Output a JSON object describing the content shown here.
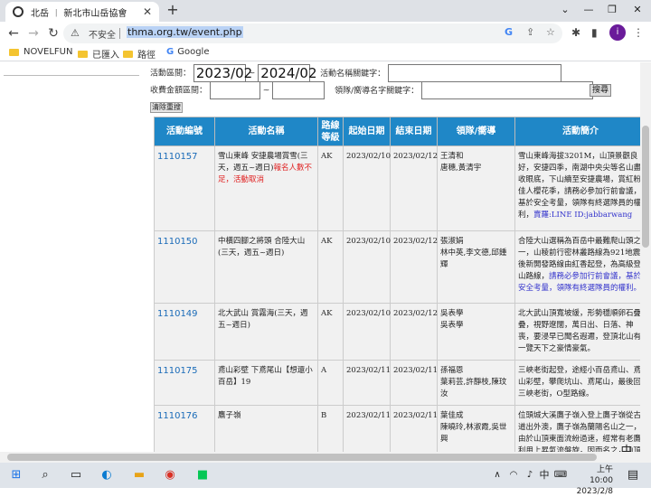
{
  "browser": {
    "tab_title": "北岳 ︱ 新北市山岳協會",
    "url": "thma.org.tw/event.php",
    "insecure_label": "不安全",
    "profile_initial": "i",
    "bookmarks": [
      "NOVELFUN",
      "已匯入",
      "路徑",
      "Google"
    ]
  },
  "search_form": {
    "date_label": "活動區間：",
    "date_from": "2023/02",
    "date_to": "2024/02",
    "name_keyword_label": "活動名稱關鍵字：",
    "fee_label": "收費金額區間：",
    "tilde": "~",
    "leader_keyword_label": "領隊/嚮導名字關鍵字：",
    "search_button": "搜尋",
    "clear_button": "清除重搜"
  },
  "table": {
    "headers": [
      "活動編號",
      "活動名稱",
      "路線等級",
      "起始日期",
      "結束日期",
      "領隊/嚮導",
      "活動簡介"
    ],
    "rows": [
      {
        "id": "1110157",
        "name": "雪山東峰 安捷農場賞雪(三天，週五~週日)",
        "name_note": "報名人數不足，活動取消",
        "level": "AK",
        "start": "2023/02/10",
        "end": "2023/02/12",
        "leaders": "王清和\n唐穗,黃清宇",
        "intro": "雪山東峰海拔3201M，山頂景觀良好，安捷四季，南湖中央尖等名山盡收眼底，下山續至安捷農場，賞紅粉佳人櫻花季，請務必參加行前會議，基於安全考量，領隊有終選隊員的權利，",
        "intro_link": "賣羅:LINE ID:jabbarwang"
      },
      {
        "id": "1110150",
        "name": "中橫四腳之將頭 合陸大山(三天，週五~週日)",
        "name_note": "",
        "level": "AK",
        "start": "2023/02/10",
        "end": "2023/02/12",
        "leaders": "張淑娟\n林中英,李文德,邱鍾輝",
        "intro": "合陸大山選稱為百岳中最難爬山頭之一，山稜前行密林叢路線為921地震後新開發路線由紅香起登，為高級登山路線，",
        "intro_link": "請務必參加行前會議，基於安全考量，領隊有終選隊員的權利。"
      },
      {
        "id": "1110149",
        "name": "北大武山 賞霧海(三天，週五~週日)",
        "name_note": "",
        "level": "AK",
        "start": "2023/02/10",
        "end": "2023/02/12",
        "leaders": "吳表學\n吳表學",
        "intro": "北大武山頂寬坡緩，形勢穩順卵石疊疊，視野遼闊，萬日出、日落、神喪，要浸早已聞名遐邇，登頂北山有一覽天下之豪情豪氣。",
        "intro_link": ""
      },
      {
        "id": "1110175",
        "name": "鳶山彩壁 下鳶尾山【想還小百岳】19",
        "name_note": "",
        "level": "A",
        "start": "2023/02/11",
        "end": "2023/02/11",
        "leaders": "孫福恩\n葉莉芸,許靜枝,陳玟汝",
        "intro": "三峽老街起登，途經小百岳鳶山、鳶山彩壁，攀爬坑山、鳶尾山，最後回三峽老街，O型路線。",
        "intro_link": ""
      },
      {
        "id": "1110176",
        "name": "鷹子嶺",
        "name_note": "",
        "level": "B",
        "start": "2023/02/11",
        "end": "2023/02/11",
        "leaders": "葉佳成\n陳曉玲,林淑霞,吳世興",
        "intro": "位頭城大溪鷹子嶺入登上鷹子嶺從古道出外澳，鷹子嶺為蘭陽名山之一，由於山頂東面流紛過速，經常有老鷹利用上昇氣流盤旋，因而名之，山頂360度視野極佳。",
        "intro_link": ""
      }
    ]
  },
  "taskbar": {
    "time": "上午 10:00",
    "date": "2023/2/8",
    "ime": "中"
  },
  "floatbar": [
    "中",
    "◧",
    "⧉",
    "⚙"
  ]
}
